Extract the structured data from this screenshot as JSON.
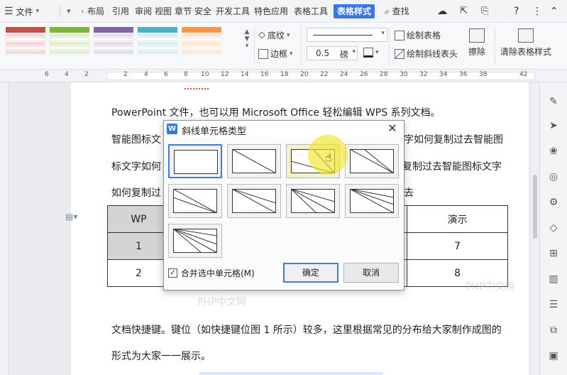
{
  "tabs": {
    "file": "文件",
    "items": [
      "布局",
      "引用",
      "审阅",
      "视图",
      "章节",
      "安全",
      "开发工具",
      "特色应用",
      "表格工具"
    ],
    "active": "表格样式",
    "search": "查找"
  },
  "ribbon": {
    "shading": "底纹",
    "border": "边框",
    "pen_width": "0.5",
    "pen_unit": "磅",
    "draw_table": "绘制表格",
    "draw_diagonal_header": "绘制斜线表头",
    "erase": "擦除",
    "clear_style": "清除表格样式"
  },
  "ruler": {
    "numbers": [
      "6",
      "4",
      "2",
      "2",
      "4",
      "6",
      "8",
      "10",
      "12",
      "14",
      "16",
      "18",
      "20",
      "22",
      "24",
      "26",
      "28",
      "30",
      "32",
      "34",
      "36",
      "38",
      "42"
    ]
  },
  "document": {
    "line1": "PowerPoint 文件，也可以用 Microsoft Office 轻松编辑 WPS 系列文档。",
    "line2a": "智能图标文",
    "line2b": "字如何复制过去智能图",
    "line3a": "标文字如何",
    "line3b": "复制过去智能图标文字",
    "line4a": "如何复制过",
    "line4b": "去",
    "table": {
      "r1c1": "WP",
      "r1c4": "演示",
      "r2c1": "1",
      "r2c4": "7",
      "r3c1": "2",
      "r3c4": "8"
    },
    "line5": "文档快捷键。键位（如快捷键位图 1 所示）较多，这里根据常见的分布给大家制作成图的",
    "line6": "形式为大家一一展示。"
  },
  "watermark": "PHP中文网",
  "dialog": {
    "app_icon": "W",
    "title": "斜线单元格类型",
    "close": "✕",
    "merge_label": "合并选中单元格(M)",
    "ok": "确定",
    "cancel": "取消"
  },
  "colors": {
    "accent": "#3976e7",
    "selection": "#3b7ddd"
  }
}
